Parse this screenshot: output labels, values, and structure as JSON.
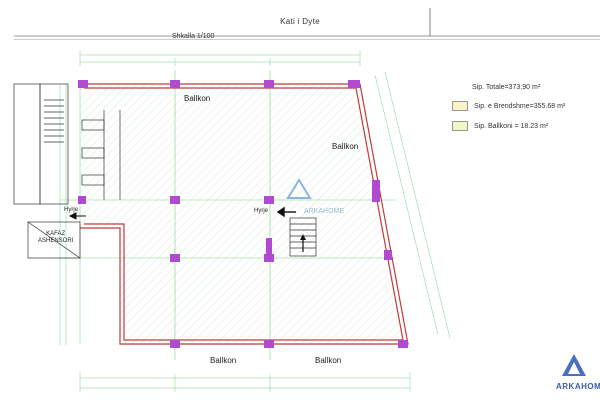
{
  "header": {
    "floor_title": "Kati i Dyte",
    "scale": "Shkalla 1/100"
  },
  "legend": {
    "total": "Sip. Totale=373.90 m²",
    "interior": "Sip. e Brendshme=355.68 m²",
    "balcony": "Sip. Ballkoni = 18.23 m²",
    "interior_color": "#fdf3c8",
    "balcony_color": "#eef7c8"
  },
  "rooms": {
    "balcony_top": "Ballkon",
    "balcony_right": "Ballkon",
    "balcony_bottom_left": "Ballkon",
    "balcony_bottom_right": "Ballkon",
    "entrance_left": "Hyrje",
    "entrance_center": "Hyrje",
    "elevator": "KAFAZ\nASHENSORI"
  },
  "colors": {
    "wall": "#c23b3b",
    "column": "#b04ad0",
    "grid": "#7fd18b",
    "hatch": "#cfe6cf"
  },
  "watermark": {
    "brand": "ARKAHOME",
    "brand_short": "ARKAHOM"
  }
}
